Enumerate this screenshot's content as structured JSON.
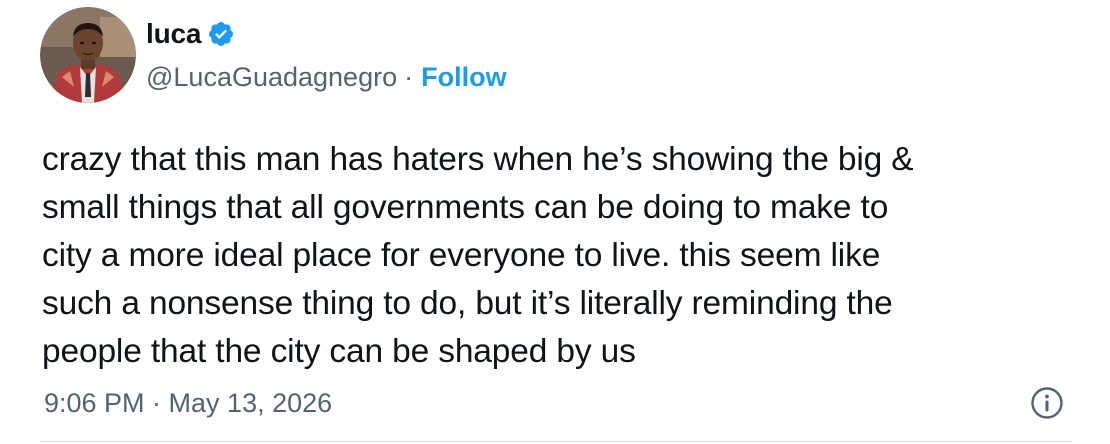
{
  "tweet": {
    "author": {
      "display_name": "luca",
      "handle": "@LucaGuadagnegro",
      "verified": true,
      "avatar_icon": "profile-photo"
    },
    "separator": "·",
    "follow_label": "Follow",
    "text": "crazy that this man has haters when he’s showing the big &\nsmall things that all governments can be doing to make to\ncity a more ideal place for everyone to live. this seem like\nsuch a nonsense thing to do, but it’s literally reminding the\npeople that the city can be shaped by us",
    "timestamp": "9:06 PM · May 13, 2026",
    "info_icon": "info-icon"
  },
  "colors": {
    "text": "#0f1419",
    "secondary": "#536471",
    "accent": "#1d9bf0",
    "divider": "#cfd9de"
  }
}
